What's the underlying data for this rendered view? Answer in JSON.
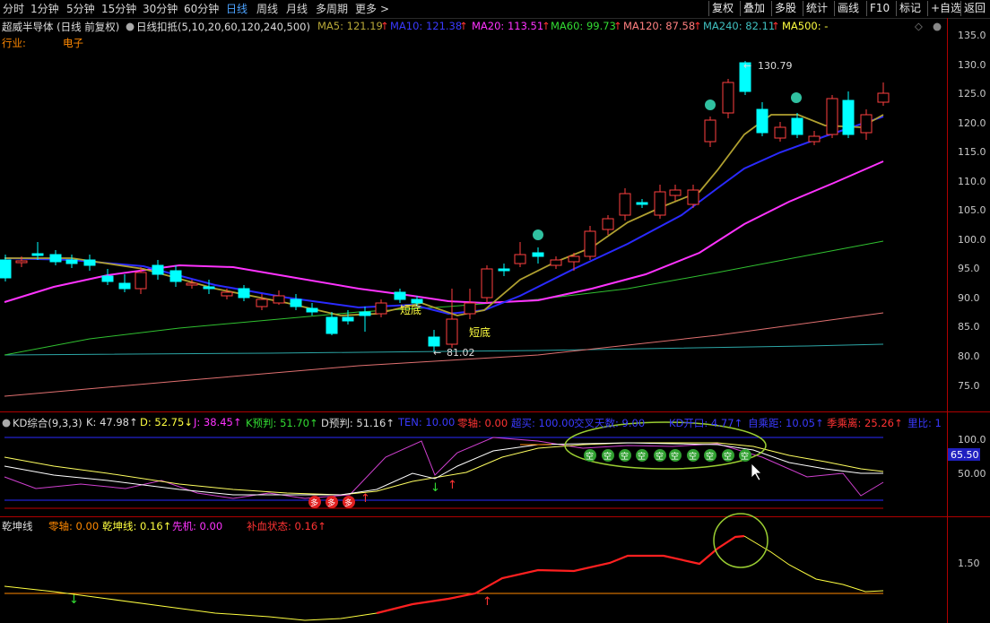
{
  "tabs": [
    {
      "label": "分时",
      "active": false
    },
    {
      "label": "1分钟",
      "active": false
    },
    {
      "label": "5分钟",
      "active": false
    },
    {
      "label": "15分钟",
      "active": false
    },
    {
      "label": "30分钟",
      "active": false
    },
    {
      "label": "60分钟",
      "active": false
    },
    {
      "label": "日线",
      "active": true
    },
    {
      "label": "周线",
      "active": false
    },
    {
      "label": "月线",
      "active": false
    },
    {
      "label": "多周期",
      "active": false
    },
    {
      "label": "更多",
      "active": false
    }
  ],
  "more_arrow": ">",
  "right_buttons": [
    "复权",
    "叠加",
    "多股",
    "统计",
    "画线",
    "F10",
    "标记",
    "+自选",
    "返回"
  ],
  "stock": {
    "title": "超威半导体 (日线 前复权)",
    "indicator": "日线扣抵(5,10,20,60,120,240,500)",
    "industry_label": "行业:",
    "industry": "电子"
  },
  "ma_legend": [
    {
      "text": "MA5: 121.19",
      "arrow": "↑",
      "color": "#b8a838"
    },
    {
      "text": "MA10: 121.38",
      "arrow": "↑",
      "color": "#3a3aff"
    },
    {
      "text": "MA20: 113.51",
      "arrow": "↑",
      "color": "#ff33ff"
    },
    {
      "text": "MA60: 99.73",
      "arrow": "↑",
      "color": "#33dd33"
    },
    {
      "text": "MA120: 87.58",
      "arrow": "↑",
      "color": "#ff8080"
    },
    {
      "text": "MA240: 82.11",
      "arrow": "↑",
      "color": "#40c0c0"
    },
    {
      "text": "MA500: -",
      "arrow": "",
      "color": "#ffff40"
    }
  ],
  "kd_legend": [
    {
      "text": "KD综合(9,3,3)",
      "color": "#dddddd"
    },
    {
      "text": "K: 47.98↑",
      "color": "#dddddd"
    },
    {
      "text": "D: 52.75↓",
      "color": "#ffff40"
    },
    {
      "text": "J: 38.45↑",
      "color": "#ff33ff"
    },
    {
      "text": "K预判: 51.70↑",
      "color": "#33dd33"
    },
    {
      "text": "D预判: 51.16↑",
      "color": "#dddddd"
    },
    {
      "text": "TEN: 10.00",
      "color": "#3a3aff"
    },
    {
      "text": "零轴: 0.00",
      "color": "#ff3333"
    },
    {
      "text": "超买: 100.00",
      "color": "#3a3aff"
    },
    {
      "text": "交叉天数: 9.00",
      "color": "#3a3aff"
    },
    {
      "text": "KD开口: 4.77↑",
      "color": "#3a3aff"
    },
    {
      "text": "自乘距: 10.05↑",
      "color": "#3a3aff"
    },
    {
      "text": "季乘离: 25.26↑",
      "color": "#ff3333"
    },
    {
      "text": "里比: 1",
      "color": "#3a3aff"
    }
  ],
  "qk_legend": [
    {
      "text": "乾坤线",
      "color": "#dddddd"
    },
    {
      "text": "零轴: 0.00",
      "color": "#ff8800"
    },
    {
      "text": "乾坤线: 0.16↑",
      "color": "#ffff40"
    },
    {
      "text": "先机: 0.00",
      "color": "#ff33ff"
    },
    {
      "text": "补血状态: 0.16↑",
      "color": "#ff3333"
    }
  ],
  "price_axis": [
    "135.0",
    "130.0",
    "125.0",
    "120.0",
    "115.0",
    "110.0",
    "105.0",
    "100.0",
    "95.0",
    "90.0",
    "85.0",
    "80.0",
    "75.0"
  ],
  "kd_axis": [
    "100.0",
    "50.00"
  ],
  "kd_value_tag": "65.50",
  "qk_axis": [
    "1.50"
  ],
  "annotations": {
    "high": "130.79",
    "low": "81.02",
    "bottom1": "短底",
    "bottom2": "短底"
  },
  "signals": {
    "buy": "多",
    "empty": "空"
  },
  "colors": {
    "up": "#ff4040",
    "down": "#00ffff",
    "bg": "#000000",
    "sep": "#b00000"
  }
}
